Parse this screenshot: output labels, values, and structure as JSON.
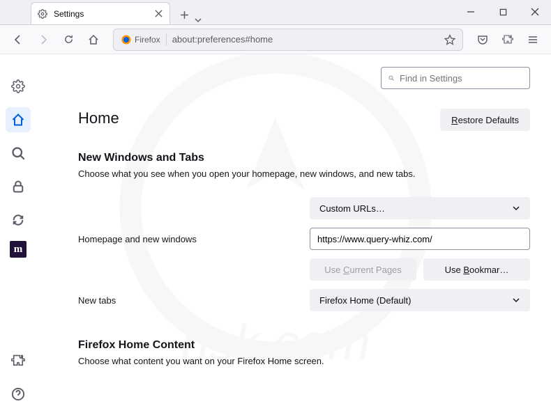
{
  "tab": {
    "title": "Settings"
  },
  "urlbar": {
    "brand": "Firefox",
    "url": "about:preferences#home"
  },
  "search": {
    "placeholder": "Find in Settings"
  },
  "page": {
    "title": "Home",
    "restore_label": "Restore Defaults",
    "restore_underline": "R"
  },
  "section1": {
    "heading": "New Windows and Tabs",
    "sub": "Choose what you see when you open your homepage, new windows, and new tabs.",
    "homepage_dropdown": "Custom URLs…",
    "homepage_label": "Homepage and new windows",
    "homepage_url": "https://www.query-whiz.com/",
    "use_current": "Use Current Pages",
    "use_current_underline": "C",
    "use_bookmark": "Use Bookmar…",
    "use_bookmark_underline": "B",
    "newtabs_label": "New tabs",
    "newtabs_dropdown": "Firefox Home (Default)"
  },
  "section2": {
    "heading": "Firefox Home Content",
    "sub": "Choose what content you want on your Firefox Home screen."
  }
}
